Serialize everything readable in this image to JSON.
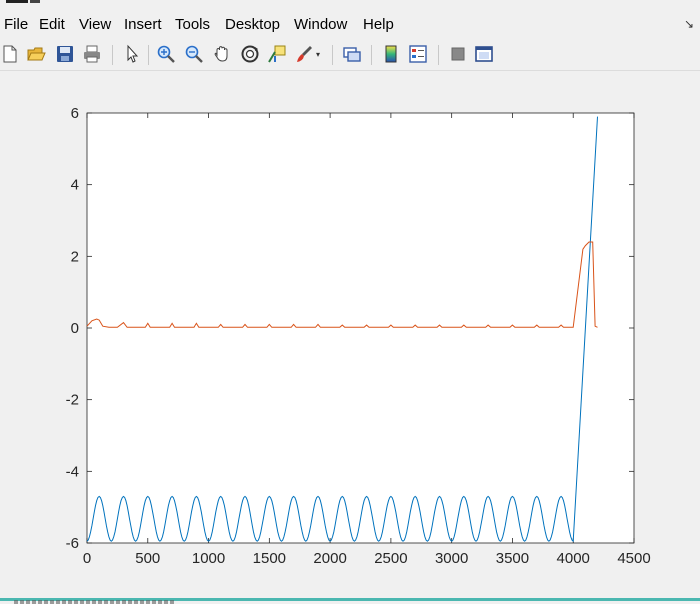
{
  "menu": [
    "File",
    "Edit",
    "View",
    "Insert",
    "Tools",
    "Desktop",
    "Window",
    "Help"
  ],
  "toolbar": {
    "icons": [
      "new-file-icon",
      "open-folder-icon",
      "save-icon",
      "print-icon",
      "pointer-icon",
      "zoom-in-icon",
      "zoom-out-icon",
      "pan-hand-icon",
      "rotate-3d-icon",
      "data-cursor-icon",
      "brush-icon",
      "dropdown-arrow-icon",
      "link-plot-icon",
      "colorbar-icon",
      "legend-icon",
      "hide-plot-tools-icon",
      "show-plot-tools-icon"
    ]
  },
  "chart_data": {
    "type": "line",
    "title": "",
    "xlabel": "",
    "ylabel": "",
    "xlim": [
      0,
      4500
    ],
    "ylim": [
      -6,
      6
    ],
    "xticks": [
      "0",
      "500",
      "1000",
      "1500",
      "2000",
      "2500",
      "3000",
      "3500",
      "4000",
      "4500"
    ],
    "yticks": [
      "6",
      "4",
      "2",
      "0",
      "-2",
      "-4",
      "-6"
    ],
    "grid": false,
    "series": [
      {
        "color": "#0072BD",
        "description_points": {
          "x": [
            0,
            50,
            100,
            150,
            200,
            250,
            300,
            350,
            400,
            450,
            500,
            550,
            600,
            650,
            700,
            750,
            800,
            850,
            900,
            950,
            1000,
            1050,
            1100,
            1150,
            1200,
            1250,
            1300,
            1350,
            1400,
            1450,
            1500,
            1550,
            1600,
            1650,
            1700,
            1750,
            1800,
            1850,
            1900,
            1950,
            2000,
            2050,
            2100,
            2150,
            2200,
            2250,
            2300,
            2350,
            2400,
            2450,
            2500,
            2550,
            2600,
            2650,
            2700,
            2750,
            2800,
            2850,
            2900,
            2950,
            3000,
            3050,
            3100,
            3150,
            3200,
            3250,
            3300,
            3350,
            3400,
            3450,
            3500,
            3550,
            3600,
            3650,
            3700,
            3750,
            3800,
            3850,
            3900,
            3950,
            4000,
            4200
          ],
          "y": [
            -5.95,
            -5.3,
            -4.7,
            -5.3,
            -5.95,
            -5.3,
            -4.7,
            -5.3,
            -5.95,
            -5.3,
            -4.7,
            -5.3,
            -5.95,
            -5.3,
            -4.7,
            -5.3,
            -5.95,
            -5.3,
            -4.7,
            -5.3,
            -5.95,
            -5.3,
            -4.7,
            -5.3,
            -5.95,
            -5.3,
            -4.7,
            -5.3,
            -5.95,
            -5.3,
            -4.7,
            -5.3,
            -5.95,
            -5.3,
            -4.7,
            -5.3,
            -5.95,
            -5.3,
            -4.7,
            -5.3,
            -5.95,
            -5.3,
            -4.7,
            -5.3,
            -5.95,
            -5.3,
            -4.7,
            -5.3,
            -5.95,
            -5.3,
            -4.7,
            -5.3,
            -5.95,
            -5.3,
            -4.7,
            -5.3,
            -5.95,
            -5.3,
            -4.7,
            -5.3,
            -5.95,
            -5.3,
            -4.7,
            -5.3,
            -5.95,
            -5.3,
            -4.7,
            -5.3,
            -5.95,
            -5.3,
            -4.7,
            -5.3,
            -5.95,
            -5.3,
            -4.7,
            -5.3,
            -5.95,
            -5.3,
            -4.7,
            -5.3,
            -5.95,
            5.9
          ]
        }
      },
      {
        "color": "#D95319",
        "description_points": {
          "x": [
            0,
            40,
            80,
            100,
            130,
            180,
            250,
            300,
            330,
            400,
            480,
            500,
            520,
            600,
            680,
            700,
            720,
            800,
            880,
            900,
            920,
            1000,
            1080,
            1100,
            1120,
            1200,
            1280,
            1300,
            1320,
            1400,
            1480,
            1500,
            1520,
            1600,
            1680,
            1700,
            1720,
            1800,
            1880,
            1900,
            1920,
            2000,
            2080,
            2100,
            2120,
            2200,
            2280,
            2300,
            2320,
            2400,
            2480,
            2500,
            2520,
            2600,
            2680,
            2700,
            2720,
            2800,
            2880,
            2900,
            2920,
            3000,
            3080,
            3100,
            3120,
            3200,
            3280,
            3300,
            3320,
            3400,
            3480,
            3500,
            3520,
            3600,
            3680,
            3700,
            3720,
            3800,
            3880,
            3900,
            3920,
            4000,
            4080,
            4100,
            4130,
            4160,
            4180,
            4200
          ],
          "y": [
            0.05,
            0.2,
            0.25,
            0.22,
            0.05,
            0.02,
            0.02,
            0.15,
            0.02,
            0.02,
            0.02,
            0.13,
            0.02,
            0.02,
            0.02,
            0.13,
            0.02,
            0.02,
            0.02,
            0.13,
            0.02,
            0.02,
            0.02,
            0.1,
            0.02,
            0.02,
            0.02,
            0.1,
            0.02,
            0.02,
            0.02,
            0.1,
            0.02,
            0.02,
            0.02,
            0.1,
            0.02,
            0.02,
            0.02,
            0.1,
            0.02,
            0.02,
            0.02,
            0.08,
            0.02,
            0.02,
            0.02,
            0.08,
            0.02,
            0.02,
            0.02,
            0.08,
            0.02,
            0.02,
            0.02,
            0.08,
            0.02,
            0.02,
            0.02,
            0.08,
            0.02,
            0.02,
            0.02,
            0.08,
            0.02,
            0.02,
            0.02,
            0.08,
            0.02,
            0.02,
            0.02,
            0.08,
            0.02,
            0.02,
            0.02,
            0.08,
            0.02,
            0.02,
            0.02,
            0.08,
            0.02,
            0.02,
            2.2,
            2.3,
            2.4,
            2.4,
            0.05,
            0.02
          ]
        }
      }
    ]
  }
}
